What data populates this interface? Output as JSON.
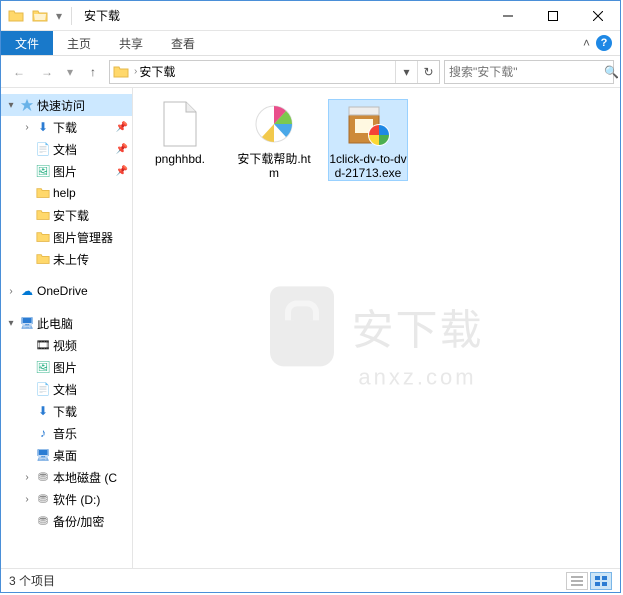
{
  "window": {
    "title": "安下载"
  },
  "ribbon": {
    "file": "文件",
    "home": "主页",
    "share": "共享",
    "view": "查看"
  },
  "nav": {
    "breadcrumb": "安下载",
    "search_placeholder": "搜索\"安下载\""
  },
  "sidebar": {
    "quick_access": "快速访问",
    "downloads": "下载",
    "documents": "文档",
    "pictures": "图片",
    "help": "help",
    "anxiazai": "安下载",
    "pic_manager": "图片管理器",
    "not_uploaded": "未上传",
    "onedrive": "OneDrive",
    "this_pc": "此电脑",
    "videos": "视频",
    "pictures2": "图片",
    "documents2": "文档",
    "downloads2": "下载",
    "music": "音乐",
    "desktop": "桌面",
    "local_disk_c": "本地磁盘 (C",
    "soft_d": "软件 (D:)",
    "backup": "备份/加密"
  },
  "files": [
    {
      "name": "pnghhbd."
    },
    {
      "name": "安下载帮助.htm"
    },
    {
      "name": "1click-dv-to-dvd-21713.exe"
    }
  ],
  "watermark": {
    "main": "安下载",
    "sub": "anxz.com"
  },
  "status": {
    "count": "3 个项目"
  }
}
